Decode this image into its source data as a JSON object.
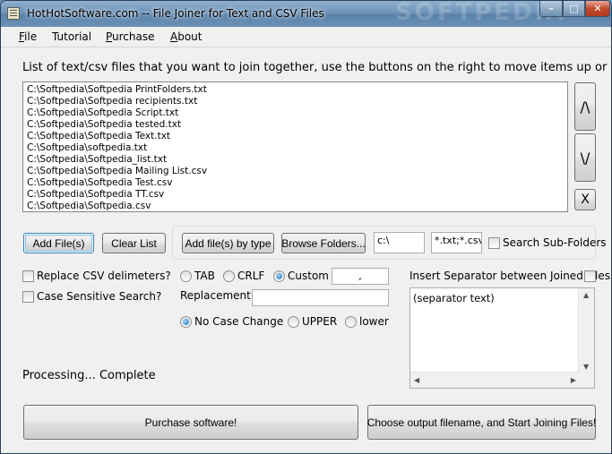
{
  "window": {
    "title": "HotHotSoftware.com -- File Joiner for Text and CSV Files",
    "watermark": "SOFTPEDIA",
    "controls": {
      "minimize": "–",
      "maximize": "□",
      "close": "✕"
    }
  },
  "menu": {
    "file": {
      "hot": "F",
      "rest": "ile"
    },
    "tutorial": "Tutorial",
    "purchase": {
      "hot": "P",
      "rest": "urchase"
    },
    "about": {
      "hot": "A",
      "rest": "bout"
    }
  },
  "list_label": "List of text/csv files that you want to join together, use the buttons on the right to move items up or down",
  "files": [
    "C:\\Softpedia\\Softpedia PrintFolders.txt",
    "C:\\Softpedia\\Softpedia recipients.txt",
    "C:\\Softpedia\\Softpedia Script.txt",
    "C:\\Softpedia\\Softpedia tested.txt",
    "C:\\Softpedia\\Softpedia Text.txt",
    "C:\\Softpedia\\softpedia.txt",
    "C:\\Softpedia\\Softpedia_list.txt",
    "C:\\Softpedia\\Softpedia Mailing List.csv",
    "C:\\Softpedia\\Softpedia Test.csv",
    "C:\\Softpedia\\Softpedia TT.csv",
    "C:\\Softpedia\\Softpedia.csv"
  ],
  "side_buttons": {
    "up": "/\\",
    "down": "\\/",
    "remove": "X"
  },
  "buttons": {
    "add_files": "Add File(s)",
    "clear_list": "Clear List",
    "add_by_type": "Add file(s) by type",
    "browse_folders": "Browse Folders...",
    "purchase": "Purchase software!",
    "start_join": "Choose output filename, and Start Joining Files!"
  },
  "folder_path": "c:\\",
  "file_types": "*.txt;*.csv",
  "search_subfolders": {
    "label": "Search Sub-Folders",
    "checked": false
  },
  "replace_csv": {
    "label": "Replace CSV delimeters?",
    "checked": false
  },
  "case_sensitive": {
    "label": "Case Sensitive Search?",
    "checked": false
  },
  "delimiters": {
    "tab": "TAB",
    "crlf": "CRLF",
    "custom": "Custom",
    "selected": "custom",
    "custom_value": ","
  },
  "replacement": {
    "label": "Replacement",
    "value": ""
  },
  "case_mode": {
    "no_change": "No Case Change",
    "upper": "UPPER",
    "lower": "lower",
    "selected": "no_change"
  },
  "separator": {
    "label": "Insert Separator between Joined Files",
    "checked": false,
    "text": "(separator text)"
  },
  "status": "Processing... Complete",
  "colors": {
    "titlebar": "#6e93b8",
    "close_button": "#c24a2e",
    "focus": "#75c5ea"
  }
}
